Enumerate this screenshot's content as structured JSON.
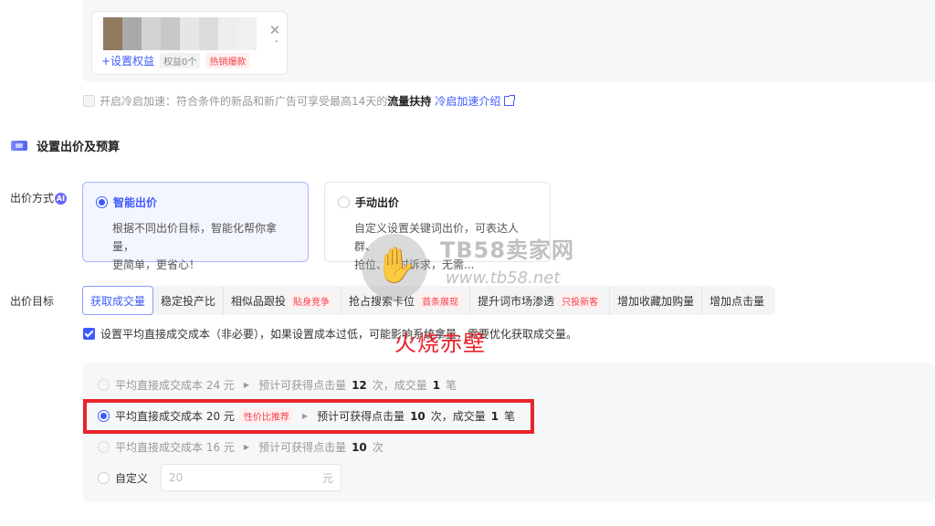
{
  "product": {
    "blur_colors": [
      "#8f7a5e",
      "#a9a9a9",
      "#d3d3d3",
      "#c8c8c8",
      "#e6e6e6",
      "#dcdcdc",
      "#eeeeee",
      "#f0f0f0"
    ],
    "ellipsis": ".",
    "set_rights": "+设置权益",
    "rights_count": "权益0个",
    "hot_tag": "热销爆款"
  },
  "cold_start": {
    "label": "开启冷启加速：",
    "desc": "符合条件的新品和新广告可享受最高14天的",
    "bold": "流量扶持",
    "link": "冷启加速介绍"
  },
  "section": {
    "title": "设置出价及预算"
  },
  "bid_method": {
    "label": "出价方式",
    "ai": "AI",
    "options": [
      {
        "title": "智能出价",
        "desc1": "根据不同出价目标，智能化帮你拿量，",
        "desc2": "更简单，更省心！"
      },
      {
        "title": "手动出价",
        "desc1": "自定义设置关键词出价，可表达人群、",
        "desc2": "抢位、分时诉求，无需..."
      }
    ]
  },
  "bid_goal": {
    "label": "出价目标",
    "tabs": [
      {
        "label": "获取成交量",
        "tag": ""
      },
      {
        "label": "稳定投产比",
        "tag": ""
      },
      {
        "label": "相似品跟投",
        "tag": "貼身竞争"
      },
      {
        "label": "抢占搜索卡位",
        "tag": "首条展现"
      },
      {
        "label": "提升词市场渗透",
        "tag": "只投新客"
      },
      {
        "label": "增加收藏加购量",
        "tag": ""
      },
      {
        "label": "增加点击量",
        "tag": ""
      }
    ]
  },
  "avg_cost": {
    "text": "设置平均直接成交成本（非必要），如果设置成本过低，可能影响系统拿量，需要优化获取成交量。"
  },
  "cost_options": [
    {
      "label": "平均直接成交成本 24 元",
      "tag": "",
      "est_pre": "预计可获得点击量",
      "clicks": "12",
      "mid": "次，成交量",
      "deals": "1",
      "unit": "笔"
    },
    {
      "label": "平均直接成交成本 20 元",
      "tag": "性价比推荐",
      "est_pre": "预计可获得点击量",
      "clicks": "10",
      "mid": "次，成交量",
      "deals": "1",
      "unit": "笔"
    },
    {
      "label": "平均直接成交成本 16 元",
      "tag": "",
      "est_pre": "预计可获得点击量",
      "clicks": "10",
      "mid": "次",
      "deals": "",
      "unit": ""
    }
  ],
  "custom": {
    "label": "自定义",
    "placeholder": "20",
    "unit": "元"
  },
  "watermark": {
    "name": "TB58卖家网",
    "url": "www.tb58.net",
    "hand": "✋",
    "stamp": "火烧赤壁"
  },
  "colors": {
    "accent": "#3d5afe",
    "highlight": "#e8232c"
  }
}
